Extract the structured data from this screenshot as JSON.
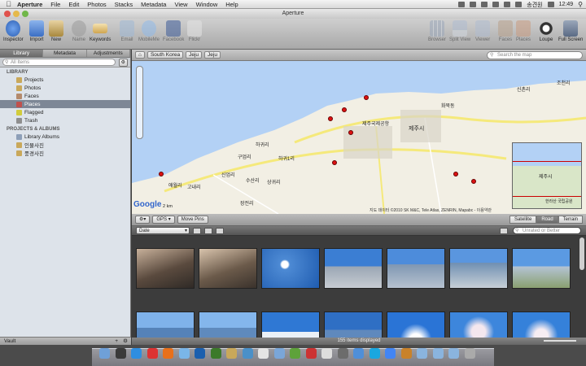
{
  "menubar": {
    "app": "Aperture",
    "items": [
      "File",
      "Edit",
      "Photos",
      "Stacks",
      "Metadata",
      "View",
      "Window",
      "Help"
    ],
    "user": "송견원",
    "time": "12:49"
  },
  "window": {
    "title": "Aperture"
  },
  "toolbar": {
    "left": [
      {
        "label": "Inspector",
        "icon": "info-icon",
        "color": "#3d74c8"
      },
      {
        "label": "Import",
        "icon": "import-icon",
        "color": "#4a82d6"
      },
      {
        "label": "New",
        "icon": "new-project-icon",
        "color": "#b89a4e"
      },
      {
        "label": "Name",
        "icon": "name-icon",
        "color": "#9a9a9a"
      },
      {
        "label": "Keywords",
        "icon": "keywords-icon",
        "color": "#d5b86b"
      },
      {
        "label": "Email",
        "icon": "email-icon",
        "color": "#8aa6c8"
      },
      {
        "label": "MobileMe",
        "icon": "mobileme-icon",
        "color": "#79a8e0"
      },
      {
        "label": "Facebook",
        "icon": "facebook-icon",
        "color": "#3b5998"
      },
      {
        "label": "Flickr",
        "icon": "flickr-icon",
        "color": "#d8d8d8"
      }
    ],
    "right": [
      {
        "label": "Browser",
        "icon": "browser-icon"
      },
      {
        "label": "Split View",
        "icon": "split-view-icon"
      },
      {
        "label": "Viewer",
        "icon": "viewer-icon"
      },
      {
        "label": "Faces",
        "icon": "faces-icon"
      },
      {
        "label": "Places",
        "icon": "places-icon"
      },
      {
        "label": "Loupe",
        "icon": "loupe-icon"
      },
      {
        "label": "Full Screen",
        "icon": "full-screen-icon"
      }
    ]
  },
  "sidebar": {
    "tabs": [
      "Library",
      "Metadata",
      "Adjustments"
    ],
    "search_placeholder": "All Items",
    "library_header": "LIBRARY",
    "library_items": [
      {
        "label": "Projects",
        "color": "#c9a85a"
      },
      {
        "label": "Photos",
        "color": "#c9a85a"
      },
      {
        "label": "Faces",
        "color": "#b48a6c"
      },
      {
        "label": "Places",
        "color": "#c0504d"
      },
      {
        "label": "Flagged",
        "color": "#d1cc3c"
      },
      {
        "label": "Trash",
        "color": "#8e8e8e"
      }
    ],
    "albums_header": "PROJECTS & ALBUMS",
    "albums_items": [
      {
        "label": "Library Albums",
        "color": "#8d9fb8"
      },
      {
        "label": "인물사진",
        "color": "#c9a85a"
      },
      {
        "label": "풍경사진",
        "color": "#c9a85a"
      }
    ],
    "vault": "Vault"
  },
  "mapbar": {
    "crumbs": [
      "South Korea",
      "Jeju",
      "Jeju"
    ],
    "search_placeholder": "Search the map"
  },
  "map": {
    "labels": [
      "제주국제공항",
      "제주시",
      "화북동",
      "신촌리",
      "조천리",
      "구엄리",
      "하귀리",
      "하귀1리",
      "애월리",
      "신엄리",
      "고내리",
      "수산리",
      "상귀리",
      "장전리",
      "한라산 국립공원",
      "제주시"
    ],
    "attribution": "지도 데이터 ©2010 SK M&C, Tele Atlas, ZENRIN, Mapabc - 이용약관",
    "google": "Google",
    "scale": "2 km"
  },
  "mapctl": {
    "gps": "GPS",
    "move_pins": "Move Pins",
    "types": [
      "Satellite",
      "Road",
      "Terrain"
    ],
    "active_type": "Road"
  },
  "browser": {
    "sort": "Date",
    "filter_placeholder": "Unrated or Better",
    "status": "155 items displayed"
  },
  "dock": {
    "icons": [
      "finder",
      "dashboard",
      "safari",
      "opera",
      "firefox",
      "itunes",
      "photoshop",
      "dreamweaver",
      "photos",
      "preview",
      "calendar",
      "mail",
      "evernote",
      "ical",
      "text",
      "aperture",
      "iphoto",
      "skype",
      "chrome",
      "ftp",
      "folder",
      "downloads",
      "documents",
      "trash"
    ]
  }
}
